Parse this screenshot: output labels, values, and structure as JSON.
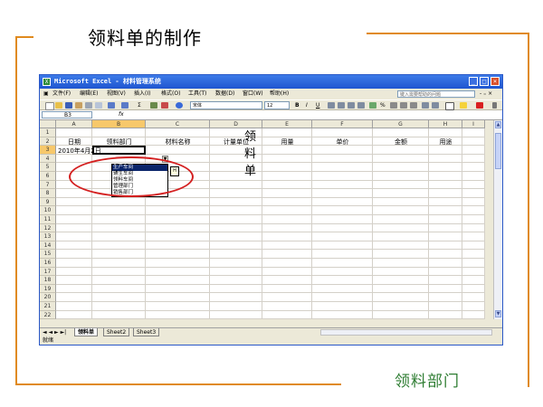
{
  "slide": {
    "title": "领料单的制作",
    "caption": "领料部门"
  },
  "window": {
    "title": "Microsoft Excel - 材料管理系统",
    "controls": [
      "_",
      "□",
      "×"
    ]
  },
  "menu": {
    "items": [
      "文件(F)",
      "编辑(E)",
      "视图(V)",
      "插入(I)",
      "格式(O)",
      "工具(T)",
      "数据(D)",
      "窗口(W)",
      "帮助(H)"
    ],
    "help_placeholder": "键入需要帮助的问题",
    "doc_controls": "- ₌ ×"
  },
  "toolbar": {
    "font_name": "宋体",
    "font_size": "12",
    "bold": "B",
    "italic": "I",
    "underline": "U",
    "percent": "%",
    "sigma": "Σ"
  },
  "formula_bar": {
    "name_box": "B3",
    "fx": "fx"
  },
  "sheet": {
    "columns": [
      "A",
      "B",
      "C",
      "D",
      "E",
      "F",
      "G",
      "H",
      "I"
    ],
    "rows": [
      "1",
      "2",
      "3",
      "4",
      "5",
      "6",
      "7",
      "8",
      "9",
      "10",
      "11",
      "12",
      "13",
      "14",
      "15",
      "16",
      "17",
      "18",
      "19",
      "20",
      "21",
      "22"
    ],
    "title_cell": "领 料 单",
    "headers": [
      "日期",
      "领料部门",
      "材料名称",
      "计量单位",
      "用量",
      "单价",
      "金额",
      "用途"
    ],
    "a3_value": "2010年4月2日"
  },
  "dropdown": {
    "options": [
      "生产车间",
      "辅生车间",
      "领料车间",
      "管理部门",
      "销售部门"
    ],
    "selected_index": 0,
    "tip": "H"
  },
  "tabs": {
    "nav": "◄ ◄ ► ►|",
    "sheets": [
      "领料单",
      "Sheet2",
      "Sheet3"
    ],
    "active": 0
  },
  "status": {
    "text": "就绪"
  }
}
